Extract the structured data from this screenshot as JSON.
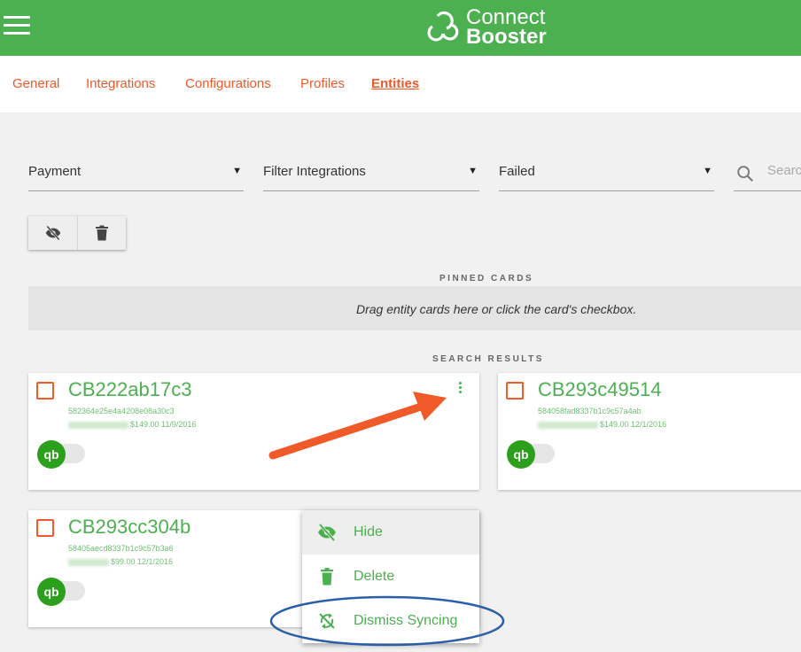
{
  "header": {
    "logo_line1": "Connect",
    "logo_line2": "Booster",
    "colors": {
      "brand": "#4caf50",
      "accent": "#f05a28"
    }
  },
  "tabs": [
    {
      "label": "General"
    },
    {
      "label": "Integrations"
    },
    {
      "label": "Configurations"
    },
    {
      "label": "Profiles"
    },
    {
      "label": "Entities",
      "active": true
    }
  ],
  "filters": {
    "entity_type": "Payment",
    "integrations": "Filter Integrations",
    "status": "Failed",
    "search_placeholder": "Search"
  },
  "toolbar": {
    "hide_icon": "eye-off-icon",
    "delete_icon": "trash-icon"
  },
  "pinned": {
    "label": "PINNED CARDS",
    "placeholder": "Drag entity cards here or click the card's checkbox."
  },
  "results_label": "SEARCH RESULTS",
  "cards": [
    {
      "title": "CB222ab17c3",
      "id": "582364e25e4a4208e08a30c3",
      "amount_date": "$149.00 11/9/2016"
    },
    {
      "title": "CB293c49514",
      "id": "584058fad8337b1c9c57a4ab",
      "amount_date": "$149.00 12/1/2016"
    },
    {
      "title": "CB293cc304b",
      "id": "58405aecd8337b1c9c57b3a6",
      "amount_date": "$99.00 12/1/2016"
    }
  ],
  "card_menu": [
    {
      "label": "Hide",
      "icon": "eye-off-icon"
    },
    {
      "label": "Delete",
      "icon": "trash-icon"
    },
    {
      "label": "Dismiss Syncing",
      "icon": "sync-off-icon"
    }
  ]
}
